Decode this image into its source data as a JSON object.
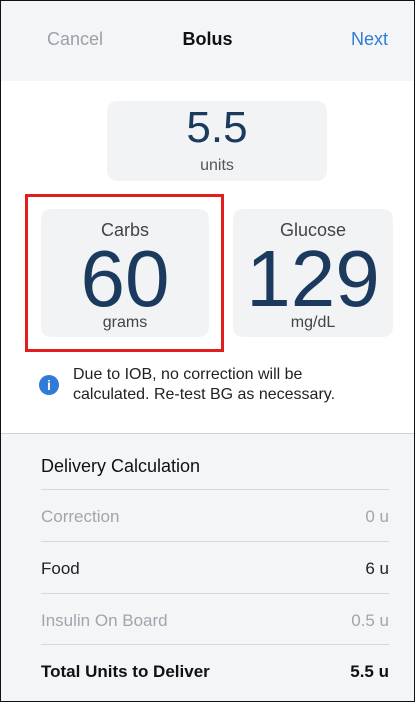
{
  "header": {
    "cancel_label": "Cancel",
    "title": "Bolus",
    "next_label": "Next"
  },
  "units": {
    "value": "5.5",
    "label": "units"
  },
  "carbs": {
    "title": "Carbs",
    "value": "60",
    "unit": "grams"
  },
  "glucose": {
    "title": "Glucose",
    "value": "129",
    "unit": "mg/dL"
  },
  "info": {
    "icon": "info-icon",
    "line1": "Due to IOB, no correction will be",
    "line2": "calculated. Re-test BG as necessary."
  },
  "delivery": {
    "title": "Delivery Calculation",
    "rows": [
      {
        "label": "Correction",
        "value": "0 u"
      },
      {
        "label": "Food",
        "value": "6 u"
      },
      {
        "label": "Insulin On Board",
        "value": "0.5 u"
      },
      {
        "label": "Total Units to Deliver",
        "value": "5.5 u"
      }
    ]
  },
  "colors": {
    "accent": "#2f7bd7",
    "value_text": "#1c3a5e",
    "highlight": "#e21d1d"
  }
}
